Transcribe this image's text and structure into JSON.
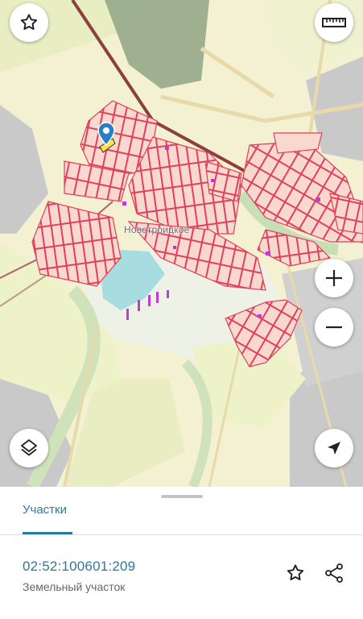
{
  "map": {
    "place_label": "Новотроицкое"
  },
  "sheet": {
    "tab_label": "Участки",
    "parcel": {
      "cadastral_number": "02:52:100601:209",
      "type": "Земельный участок"
    }
  },
  "icons": {
    "favorite": "star-outline-icon",
    "ruler": "ruler-icon",
    "zoom_in": "plus-icon",
    "zoom_out": "minus-icon",
    "layers": "layers-icon",
    "locate": "navigation-arrow-icon",
    "pin": "map-pin-icon",
    "share": "share-icon"
  },
  "colors": {
    "accent": "#2b7a9e",
    "parcel_stroke": "#e0405a",
    "parcel_fill": "#f8d8cf",
    "road": "#9c3d3d"
  }
}
